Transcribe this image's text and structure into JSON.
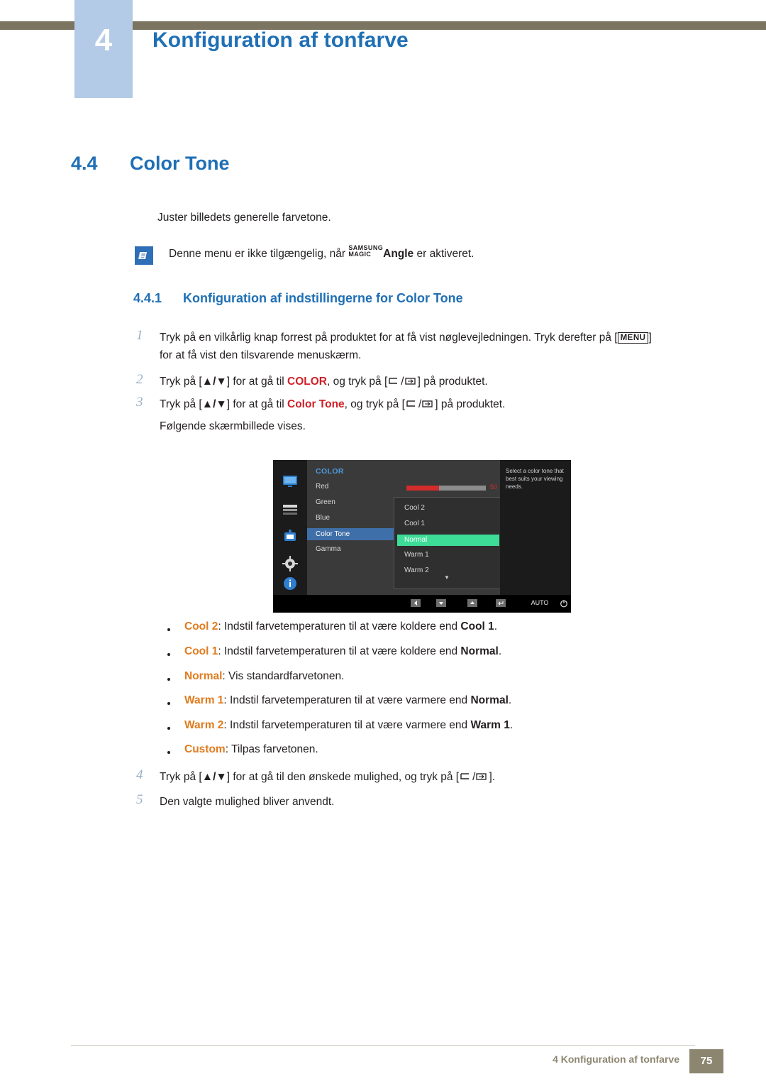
{
  "header": {
    "chapter_number": "4",
    "chapter_title": "Konfiguration af tonfarve"
  },
  "section": {
    "number": "4.4",
    "title": "Color Tone",
    "intro": "Juster billedets generelle farvetone.",
    "note": {
      "prefix": "Denne menu er ikke tilgængelig, når",
      "magic_top": "SAMSUNG",
      "magic_bottom": "MAGIC",
      "magic_suffix": "Angle",
      "suffix": "er aktiveret."
    }
  },
  "subsection": {
    "number": "4.4.1",
    "title": "Konfiguration af indstillingerne for Color Tone"
  },
  "steps": {
    "s1_num": "1",
    "s1_a": "Tryk på en vilkårlig knap forrest på produktet for at få vist nøglevejledningen. Tryk derefter på [",
    "s1_key": "MENU",
    "s1_b": "]",
    "s1_c": "for at få vist den tilsvarende menuskærm.",
    "s2_num": "2",
    "s2_a": "Tryk på [",
    "s2_b": "] for at gå til",
    "s2_target": "COLOR",
    "s2_c": ", og tryk på [",
    "s2_d": "] på produktet.",
    "s3_num": "3",
    "s3_a": "Tryk på [",
    "s3_b": "] for at gå til",
    "s3_target": "Color Tone",
    "s3_c": ", og tryk på [",
    "s3_d": "] på produktet.",
    "s3_follow": "Følgende skærmbillede vises.",
    "s4_num": "4",
    "s4_a": "Tryk på [",
    "s4_b": "] for at gå til den ønskede mulighed, og tryk på [",
    "s4_c": "].",
    "s5_num": "5",
    "s5_text": "Den valgte mulighed bliver anvendt."
  },
  "osd": {
    "title": "COLOR",
    "menu_items": [
      "Red",
      "Green",
      "Blue",
      "Color Tone",
      "Gamma"
    ],
    "selected_item": "Color Tone",
    "slider_value": "50",
    "popup_items": [
      "Cool 2",
      "Cool 1",
      "Normal",
      "Warm 1",
      "Warm 2"
    ],
    "popup_selected": "Normal",
    "help_text": "Select a color tone that best suits your viewing needs.",
    "buttons": [
      "AUTO"
    ],
    "icon_names": [
      "monitor-icon",
      "picture-icon",
      "color-icon",
      "setup-icon",
      "information-icon"
    ]
  },
  "bullets": [
    {
      "term": "Cool 2",
      "rest_before": ": Indstil farvetemperaturen til at være koldere end ",
      "ref": "Cool 1",
      "rest_after": "."
    },
    {
      "term": "Cool 1",
      "rest_before": ": Indstil farvetemperaturen til at være koldere end ",
      "ref": "Normal",
      "rest_after": "."
    },
    {
      "term": "Normal",
      "rest_before": ": Vis standardfarvetonen.",
      "ref": "",
      "rest_after": ""
    },
    {
      "term": "Warm 1",
      "rest_before": ": Indstil farvetemperaturen til at være varmere end ",
      "ref": "Normal",
      "rest_after": "."
    },
    {
      "term": "Warm 2",
      "rest_before": ": Indstil farvetemperaturen til at være varmere end ",
      "ref": "Warm 1",
      "rest_after": "."
    },
    {
      "term": "Custom",
      "rest_before": ": Tilpas farvetonen.",
      "ref": "",
      "rest_after": ""
    }
  ],
  "footer": {
    "text": "4 Konfiguration af tonfarve",
    "page": "75"
  },
  "colors": {
    "accent_blue": "#1f6fb5",
    "chapter_box": "#b3cbe6",
    "orange": "#e07b1e",
    "red": "#cf2027",
    "footer": "#8c8570"
  }
}
